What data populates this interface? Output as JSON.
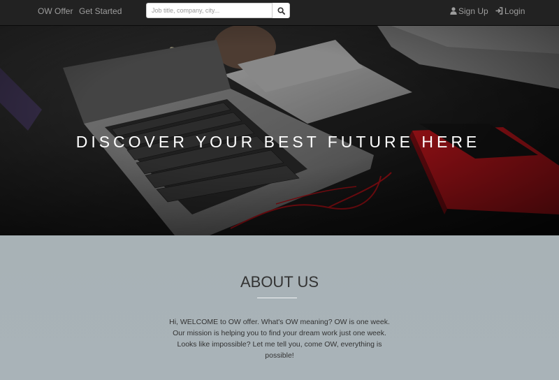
{
  "navbar": {
    "brand_label": "OW Offer",
    "get_started_label": "Get Started",
    "search": {
      "placeholder": "Job title, company, city...",
      "value": "",
      "icon": "search-icon"
    },
    "signup_label": "Sign Up",
    "signup_icon": "user-icon",
    "login_label": "Login",
    "login_icon": "login-icon"
  },
  "hero": {
    "title": "DISCOVER YOUR BEST FUTURE HERE"
  },
  "about": {
    "title": "ABOUT US",
    "text": "Hi, WELCOME to OW offer. What's OW meaning? OW is one week. Our mission is helping you to find your dream work just one week. Looks like impossible? Let me tell you, come OW, everything is possible!"
  },
  "colors": {
    "navbar_bg": "#222222",
    "nav_text": "#9d9d9d",
    "about_bg": "#a9b3b8",
    "accent_red": "#c0161d"
  }
}
